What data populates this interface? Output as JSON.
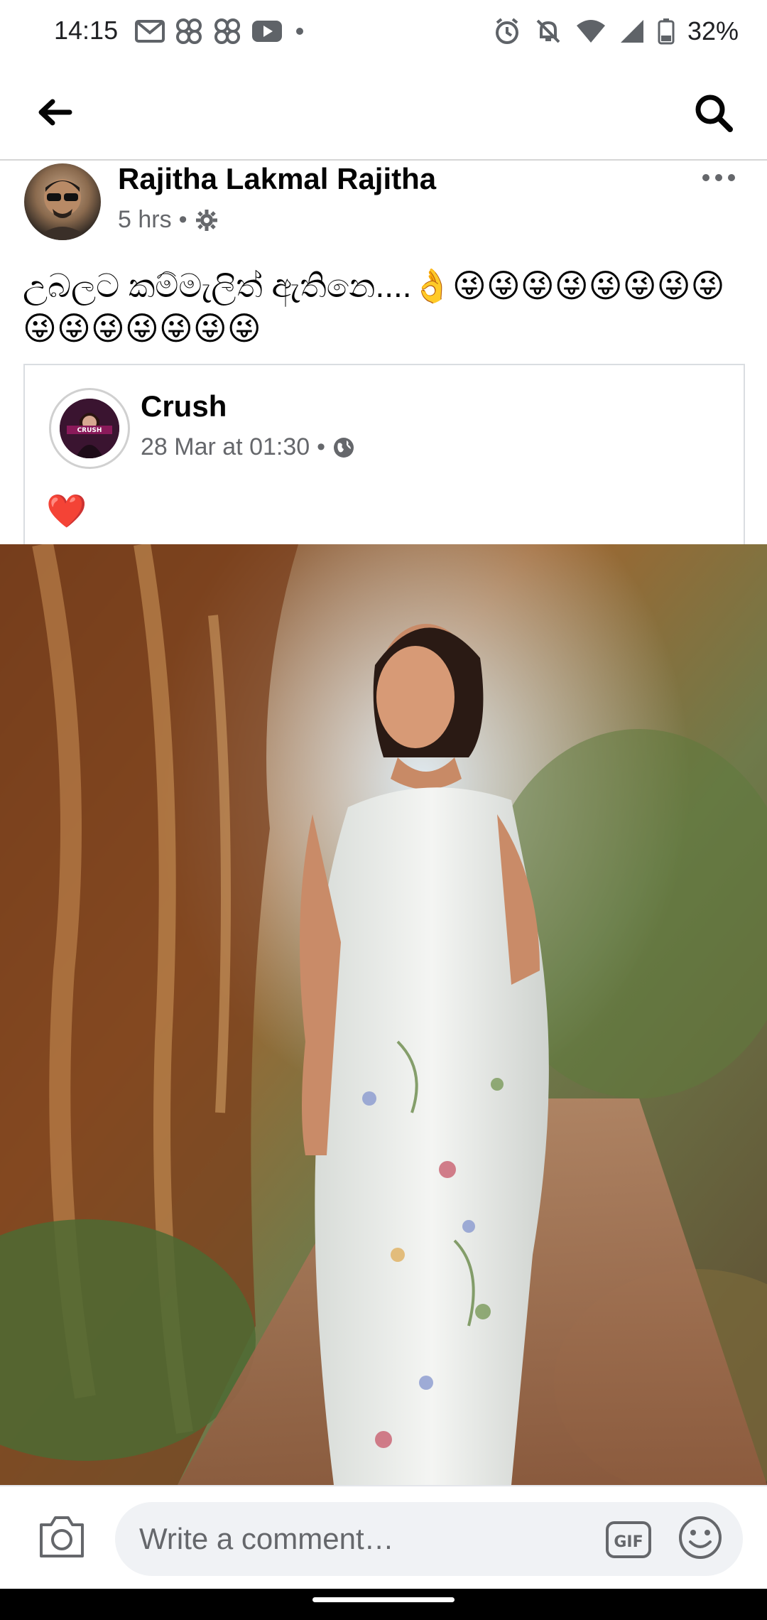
{
  "status_bar": {
    "time": "14:15",
    "battery": "32%"
  },
  "app_bar": {
    "back_icon": "arrow-left-icon",
    "search_icon": "search-icon"
  },
  "post": {
    "author": "Rajitha Lakmal Rajitha",
    "time": "5 hrs",
    "separator": "•",
    "privacy_icon": "gear-icon",
    "text": "උබලට කම්මැලිත් ඇතිනෙ....👌😜😜😜😜😜😜😜😜😜😜😜😜😜😜😜"
  },
  "shared": {
    "page_name": "Crush",
    "date": "28 Mar at 01:30",
    "separator": "•",
    "privacy_icon": "globe-icon",
    "avatar_text": "CRUSH",
    "text": "❤️"
  },
  "comment_bar": {
    "placeholder": "Write a comment…",
    "gif_label": "GIF"
  }
}
